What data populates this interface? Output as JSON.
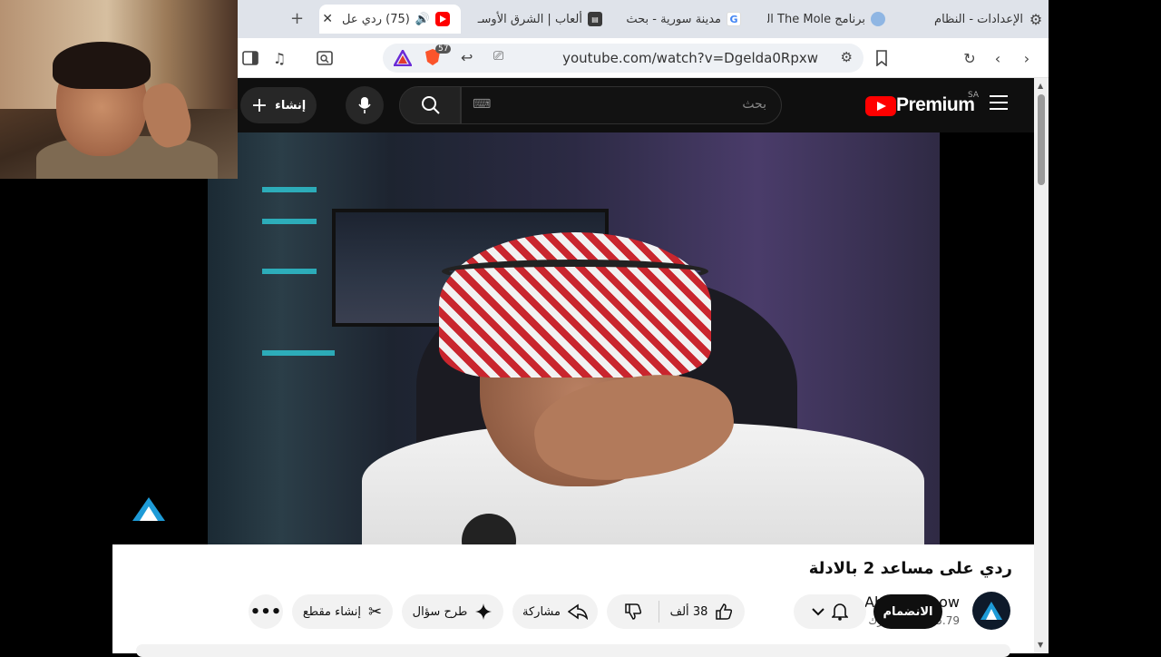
{
  "browser": {
    "tabs": [
      {
        "title": "الإعدادات - النظام",
        "icon": "gear-icon",
        "active": false
      },
      {
        "title": "برنامج The Mole الـ",
        "icon": "globe-icon",
        "active": false
      },
      {
        "title": "مدينة سورية - بحث",
        "icon": "google-icon",
        "active": false
      },
      {
        "title": "ألعاب | الشرق الأوسـ",
        "icon": "news-icon",
        "active": false
      },
      {
        "title": "(75) ردي عل",
        "icon": "youtube-icon",
        "active": true
      }
    ],
    "new_tab_label": "+",
    "url": "youtube.com/watch?v=Dgelda0Rpxw",
    "shield_count": "57"
  },
  "youtube": {
    "logo_text": "Premium",
    "region": "SA",
    "search_placeholder": "بحث",
    "create_label": "إنشاء",
    "video_title": "ردي على مساعد 2 بالادلة",
    "channel_name": "Ahmed Show",
    "subscribers": "5.79 مليون مشترك",
    "join_label": "الانضمام",
    "likes": "38 ألف",
    "share_label": "مشاركة",
    "ask_label": "طرح سؤال",
    "clip_label": "إنشاء مقطع"
  },
  "colors": {
    "youtube_red": "#ff0000",
    "dark_bg": "#0f0f0f",
    "tab_bar": "#dfe3ea"
  }
}
